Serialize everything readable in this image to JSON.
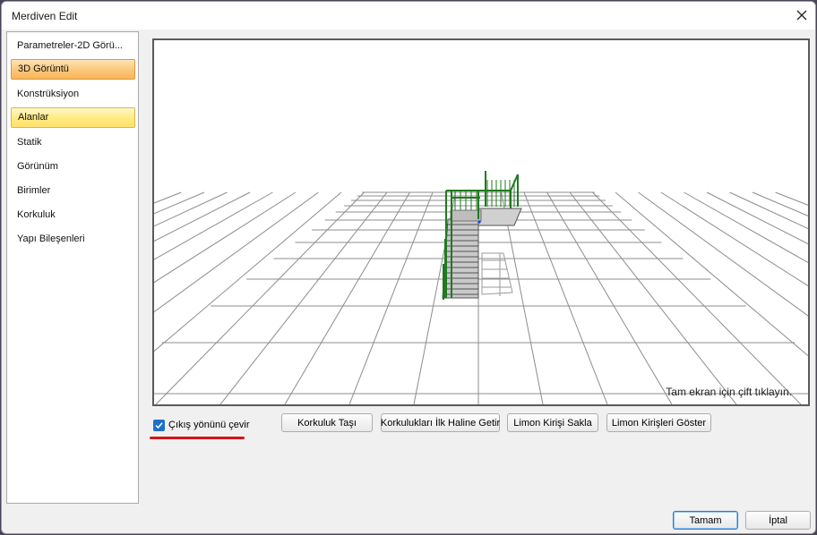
{
  "window": {
    "title": "Merdiven Edit"
  },
  "sidebar": {
    "items": [
      {
        "label": "Parametreler-2D Görü..."
      },
      {
        "label": "3D Görüntü"
      },
      {
        "label": "Konstrüksiyon"
      },
      {
        "label": "Alanlar"
      },
      {
        "label": "Statik"
      },
      {
        "label": "Görünüm"
      },
      {
        "label": "Birimler"
      },
      {
        "label": "Korkuluk"
      },
      {
        "label": "Yapı Bileşenleri"
      }
    ]
  },
  "viewport": {
    "hint": "Tam ekran için çift tıklayın."
  },
  "options": {
    "reverse_exit_label": "Çıkış yönünü çevir",
    "reverse_exit_checked": true
  },
  "actions": {
    "move_railing": "Korkuluk Taşı",
    "reset_railings": "Korkulukları İlk Haline Getir",
    "hide_stringer": "Limon Kirişi Sakla",
    "show_stringers": "Limon Kirişleri Göster"
  },
  "footer": {
    "ok": "Tamam",
    "cancel": "İptal"
  },
  "colors": {
    "railing": "#1f7a1f",
    "stair_fill": "#c9c9c9",
    "grid": "#8c8c8c",
    "accent_underline": "#d8121a"
  }
}
